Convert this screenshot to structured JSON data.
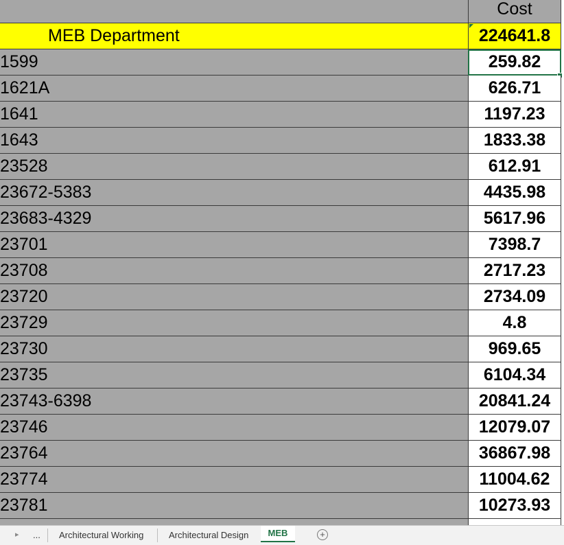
{
  "header": {
    "cost_label": "Cost"
  },
  "department": {
    "label": "MEB Department",
    "total": "224641.8"
  },
  "rows": [
    {
      "id": "1599",
      "cost": "259.82"
    },
    {
      "id": "1621A",
      "cost": "626.71"
    },
    {
      "id": "1641",
      "cost": "1197.23"
    },
    {
      "id": "1643",
      "cost": "1833.38"
    },
    {
      "id": "23528",
      "cost": "612.91"
    },
    {
      "id": "23672-5383",
      "cost": "4435.98"
    },
    {
      "id": "23683-4329",
      "cost": "5617.96"
    },
    {
      "id": "23701",
      "cost": "7398.7"
    },
    {
      "id": "23708",
      "cost": "2717.23"
    },
    {
      "id": "23720",
      "cost": "2734.09"
    },
    {
      "id": "23729",
      "cost": "4.8"
    },
    {
      "id": "23730",
      "cost": "969.65"
    },
    {
      "id": "23735",
      "cost": "6104.34"
    },
    {
      "id": "23743-6398",
      "cost": "20841.24"
    },
    {
      "id": "23746",
      "cost": "12079.07"
    },
    {
      "id": "23764",
      "cost": "36867.98"
    },
    {
      "id": "23774",
      "cost": "11004.62"
    },
    {
      "id": "23781",
      "cost": "10273.93"
    }
  ],
  "tabs": {
    "overflow": "...",
    "items": [
      "Architectural Working",
      "Architectural Design"
    ],
    "active": "MEB",
    "add_symbol": "+"
  },
  "colors": {
    "highlight": "#ffff00",
    "gray_fill": "#a6a6a6",
    "excel_green": "#217346"
  },
  "icons": {
    "tab_scroll": "triangle-right-icon",
    "add_sheet": "plus-circle-icon"
  }
}
